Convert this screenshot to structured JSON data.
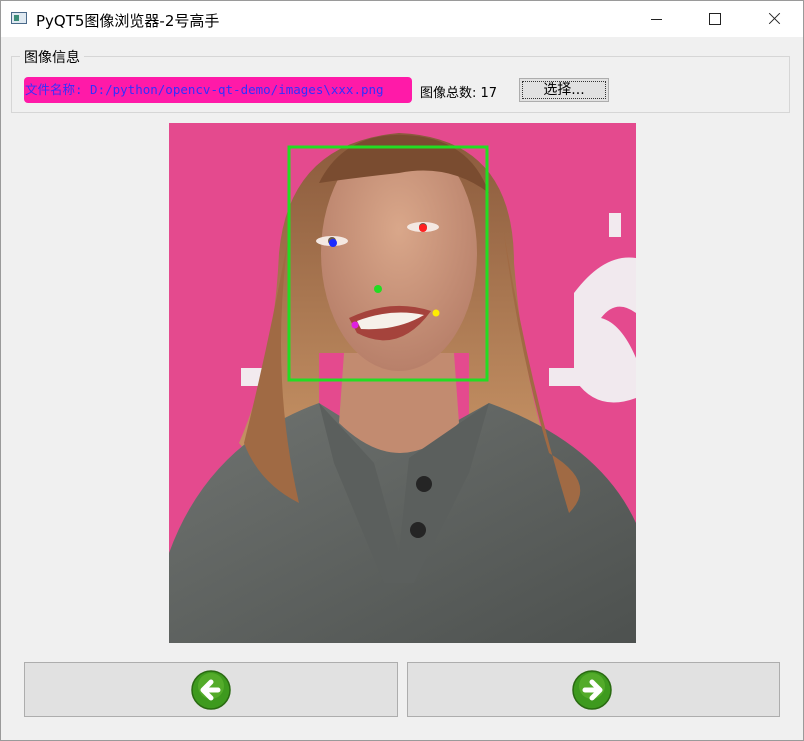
{
  "window": {
    "title": "PyQT5图像浏览器-2号高手",
    "icon": "app-window-icon",
    "controls": [
      "minimize-icon",
      "maximize-icon",
      "close-icon"
    ]
  },
  "group": {
    "title": "图像信息",
    "file_label": "文件名称: D:/python/opencv-qt-demo/images\\xxx.png",
    "count_label": "图像总数: 17",
    "select_button": "选择..."
  },
  "image": {
    "description_icon": "portrait-photo",
    "face_box_color": "#22dd22",
    "landmarks": [
      {
        "name": "right-eye",
        "color": "#1a2aff"
      },
      {
        "name": "left-eye",
        "color": "#ff2020"
      },
      {
        "name": "nose",
        "color": "#22dd22"
      },
      {
        "name": "mouth-right",
        "color": "#e020e0"
      },
      {
        "name": "mouth-left",
        "color": "#ffee00"
      }
    ]
  },
  "navigation": {
    "prev_icon": "arrow-left-icon",
    "next_icon": "arrow-right-icon"
  },
  "colors": {
    "file_label_bg": "#ff1aa8",
    "file_label_text": "#3030ff",
    "arrow_green": "#3e9a1e"
  }
}
